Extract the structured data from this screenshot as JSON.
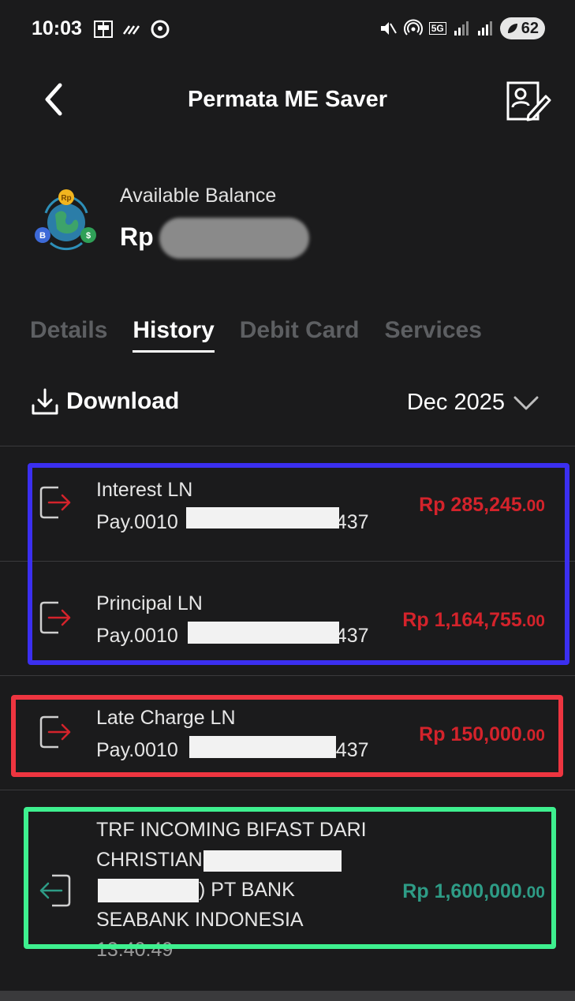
{
  "status_bar": {
    "time": "10:03",
    "network": "5G",
    "battery": "62"
  },
  "header": {
    "title": "Permata ME Saver"
  },
  "balance": {
    "label": "Available Balance",
    "currency": "Rp"
  },
  "tabs": [
    {
      "label": "Details",
      "active": false
    },
    {
      "label": "History",
      "active": true
    },
    {
      "label": "Debit Card",
      "active": false
    },
    {
      "label": "Services",
      "active": false
    }
  ],
  "toolbar": {
    "download_label": "Download",
    "month": "Dec 2025"
  },
  "transactions": [
    {
      "title": "Interest LN",
      "ref_start": "Pay.0010",
      "ref_end": "437",
      "amount": "Rp 285,245",
      "decimals": ".00",
      "direction": "out"
    },
    {
      "title": "Principal LN",
      "ref_start": "Pay.0010",
      "ref_end": "437",
      "amount": "Rp 1,164,755",
      "decimals": ".00",
      "direction": "out"
    },
    {
      "title": "Late Charge LN",
      "ref_start": "Pay.0010",
      "ref_end": "437",
      "amount": "Rp 150,000",
      "decimals": ".00",
      "direction": "out"
    },
    {
      "line1": "TRF INCOMING BIFAST DARI",
      "line2": "CHRISTIAN",
      "line3_end": ") PT BANK",
      "line4": "SEABANK INDONESIA",
      "line5": "13:40:49",
      "amount": "Rp 1,600,000",
      "decimals": ".00",
      "direction": "in"
    }
  ],
  "colors": {
    "background": "#1b1b1c",
    "debit": "#d4232b",
    "credit": "#2e9c86",
    "highlight_blue": "#3b2ff0",
    "highlight_red": "#ee3540",
    "highlight_green": "#3ef08f"
  }
}
